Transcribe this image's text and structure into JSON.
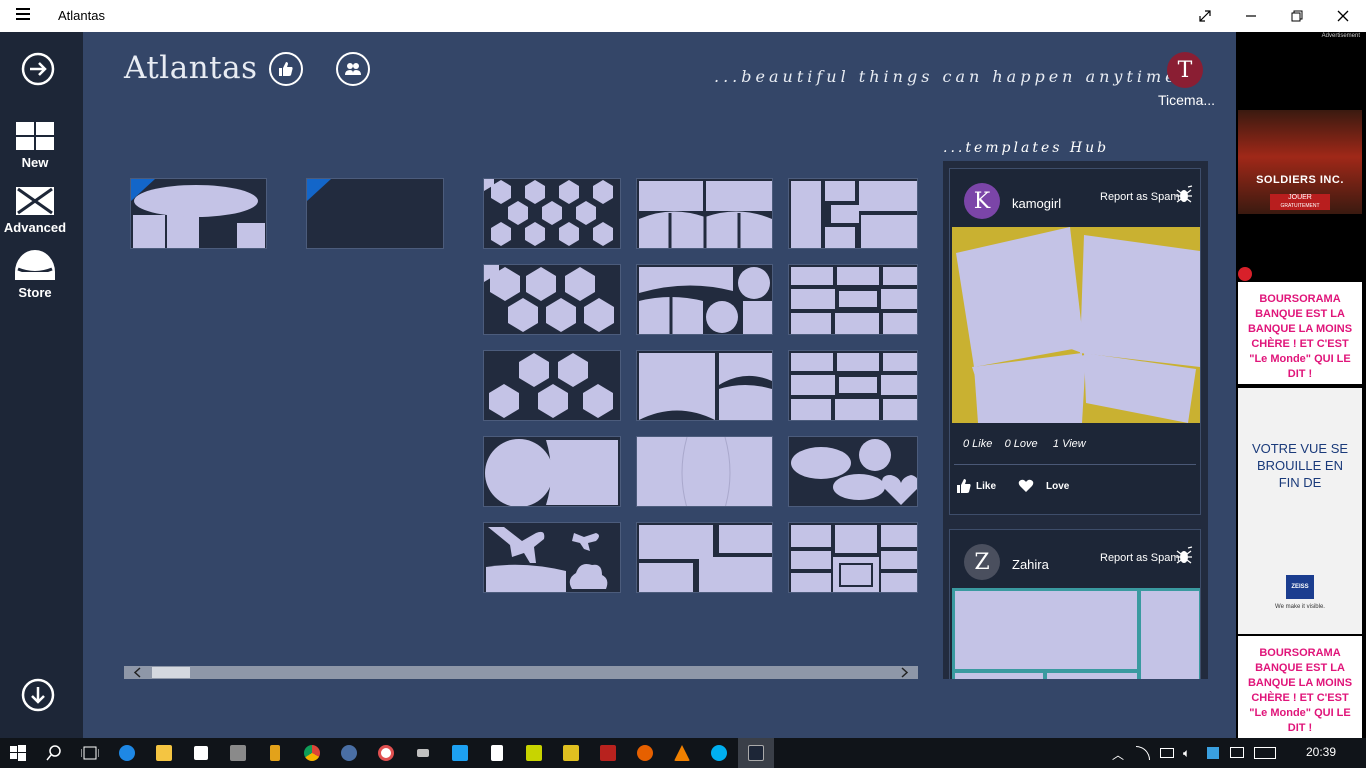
{
  "window": {
    "title": "Atlantas",
    "controls": [
      "expand",
      "minimize",
      "maximize",
      "close"
    ]
  },
  "rail": {
    "items": [
      {
        "label": "New",
        "icon": "grid-icon"
      },
      {
        "label": "Advanced",
        "icon": "envelope-x-icon"
      },
      {
        "label": "Store",
        "icon": "dome-icon"
      }
    ]
  },
  "header": {
    "app_title": "Atlantas",
    "tagline": "...beautiful things can happen anytime",
    "user": {
      "initial": "T",
      "name": "Ticema...",
      "color": "#8a1e33"
    }
  },
  "templates_hub": {
    "title": "...templates Hub",
    "posts": [
      {
        "initial": "K",
        "user": "kamogirl",
        "spam_label": "Report as Spam",
        "likes": "0 Like",
        "loves": "0 Love",
        "views": "1 View",
        "like_button": "Like",
        "love_button": "Love",
        "avatar_color": "#7b45a8",
        "image_bg": "#c9b131"
      },
      {
        "initial": "Z",
        "user": "Zahira",
        "spam_label": "Report as Spam",
        "avatar_color": "#4a4f5e"
      }
    ]
  },
  "ads": {
    "label": "Advertisement",
    "game_title": "SOLDIERS INC.",
    "game_cta": "JOUER",
    "game_sub": "GRATUITEMENT",
    "bank_1": "BOURSORAMA BANQUE EST LA BANQUE LA MOINS CHÈRE ! ET C'EST \"Le Monde\" QUI LE DIT !",
    "zeiss_headline": "VOTRE VUE SE BROUILLE EN FIN DE JOURNÉE",
    "zeiss_logo": "ZEISS",
    "zeiss_tagline": "We make it visible.",
    "bank_2": "BOURSORAMA BANQUE EST LA BANQUE LA MOINS CHÈRE ! ET C'EST \"Le Monde\" QUI LE DIT !"
  },
  "taskbar": {
    "time": "20:39"
  },
  "colors": {
    "background": "#344668",
    "rail": "#1d2637",
    "tile_shape": "#c4c3e6",
    "accent_blue": "#1366c9"
  }
}
